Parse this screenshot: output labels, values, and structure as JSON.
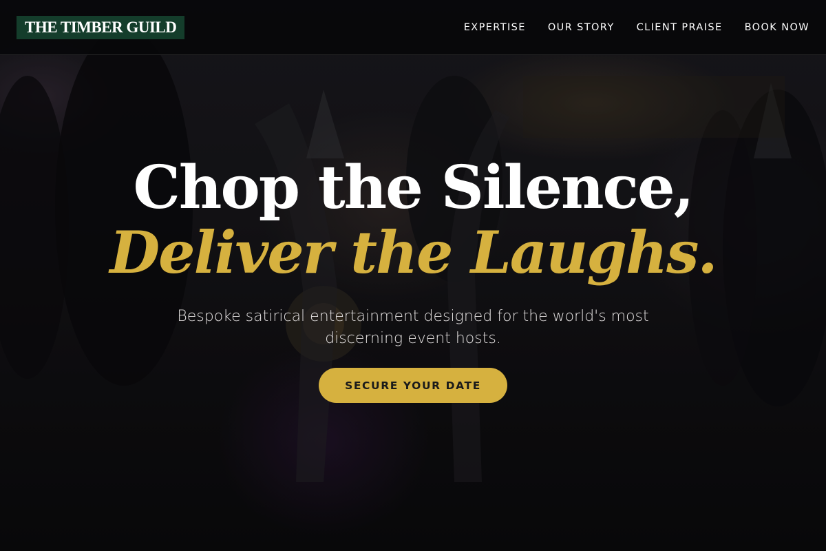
{
  "header": {
    "logo_text": "THE TIMBER GUILD",
    "nav": [
      {
        "label": "EXPERTISE"
      },
      {
        "label": "OUR STORY"
      },
      {
        "label": "CLIENT PRAISE"
      },
      {
        "label": "BOOK NOW"
      }
    ]
  },
  "hero": {
    "headline_line1": "Chop the Silence,",
    "headline_line2": "Deliver the Laughs.",
    "subtitle": "Bespoke satirical entertainment designed for the world's most discerning event hosts.",
    "cta_label": "SECURE YOUR DATE"
  },
  "colors": {
    "accent_gold": "#d6b13f",
    "logo_green": "#143d2b",
    "header_bg": "#08080a",
    "text_white": "#ffffff"
  }
}
